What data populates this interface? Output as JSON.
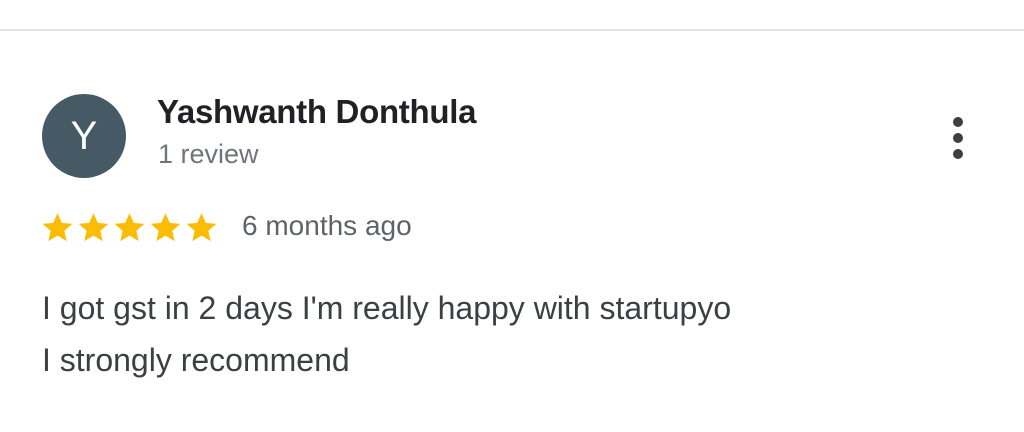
{
  "reviewer": {
    "avatar_letter": "Y",
    "avatar_color": "#455a64",
    "name": "Yashwanth Donthula",
    "review_count": "1 review"
  },
  "more_menu": {
    "icon": "more-vertical-icon"
  },
  "rating": {
    "stars": 5,
    "max_stars": 5,
    "star_color": "#fbbc04",
    "icon": "star-icon"
  },
  "review": {
    "time": "6 months ago",
    "lines": [
      "I got gst in 2 days I'm really happy with startupyo",
      "I strongly recommend"
    ]
  }
}
